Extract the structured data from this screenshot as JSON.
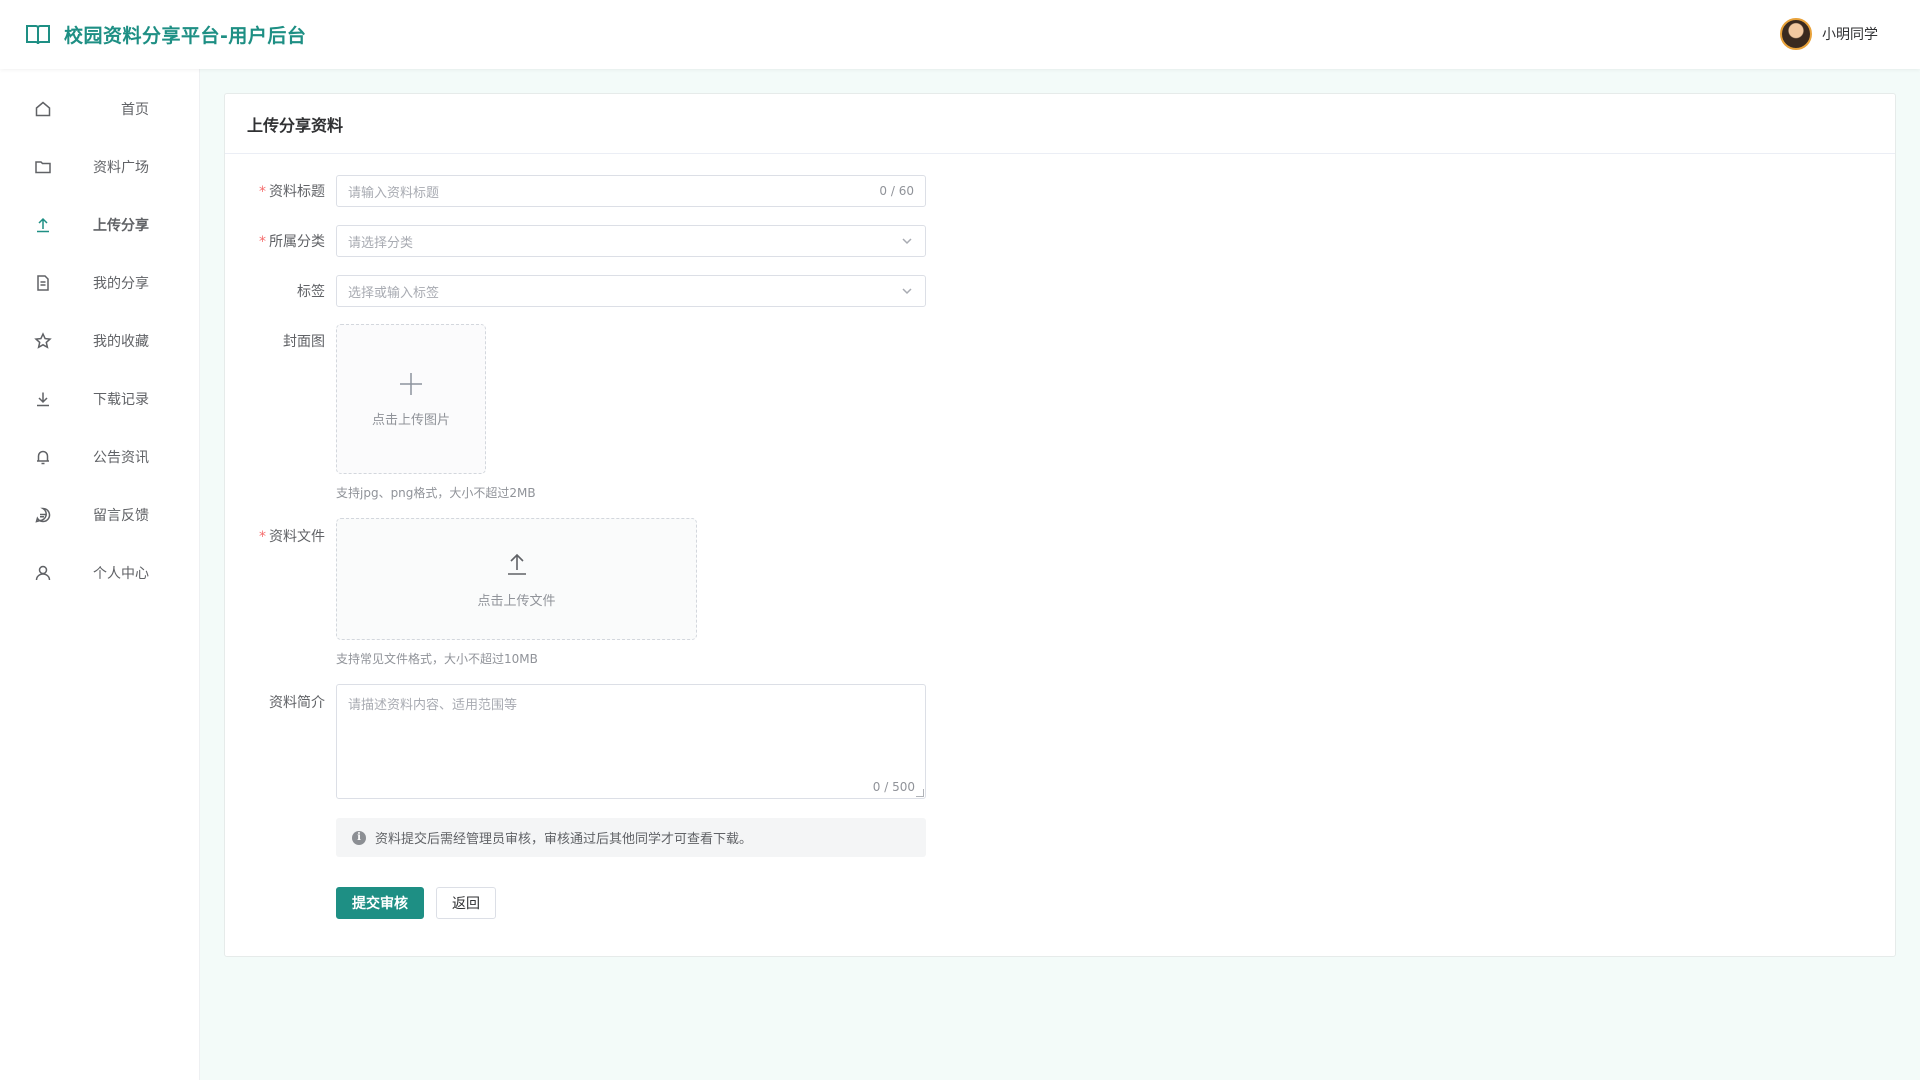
{
  "header": {
    "title": "校园资料分享平台-用户后台",
    "user_name": "小明同学"
  },
  "sidebar": {
    "items": [
      {
        "label": "首页",
        "icon": "home-icon"
      },
      {
        "label": "资料广场",
        "icon": "folder-icon"
      },
      {
        "label": "上传分享",
        "icon": "upload-icon",
        "active": true
      },
      {
        "label": "我的分享",
        "icon": "document-icon"
      },
      {
        "label": "我的收藏",
        "icon": "star-icon"
      },
      {
        "label": "下载记录",
        "icon": "download-icon"
      },
      {
        "label": "公告资讯",
        "icon": "bell-icon"
      },
      {
        "label": "留言反馈",
        "icon": "chat-icon"
      },
      {
        "label": "个人中心",
        "icon": "user-icon"
      }
    ]
  },
  "card": {
    "title": "上传分享资料"
  },
  "form": {
    "title_label": "资料标题",
    "title_placeholder": "请输入资料标题",
    "title_counter": "0 / 60",
    "category_label": "所属分类",
    "category_placeholder": "请选择分类",
    "tags_label": "标签",
    "tags_placeholder": "选择或输入标签",
    "cover_label": "封面图",
    "cover_upload_text": "点击上传图片",
    "cover_hint": "支持jpg、png格式，大小不超过2MB",
    "file_label": "资料文件",
    "file_upload_text": "点击上传文件",
    "file_hint": "支持常见文件格式，大小不超过10MB",
    "desc_label": "资料简介",
    "desc_placeholder": "请描述资料内容、适用范围等",
    "desc_counter": "0 / 500",
    "notice": "资料提交后需经管理员审核，审核通过后其他同学才可查看下载。",
    "submit_label": "提交审核",
    "back_label": "返回"
  },
  "colors": {
    "primary": "#1e8f84",
    "required": "#f56c6c",
    "page_bg": "#f3fbf9"
  }
}
